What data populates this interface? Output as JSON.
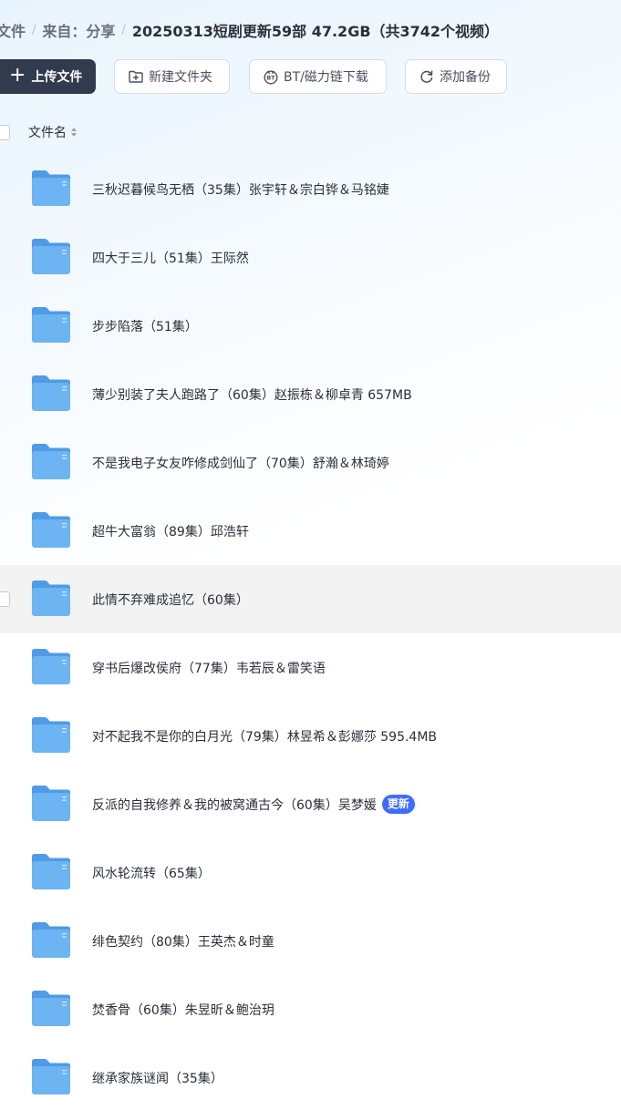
{
  "breadcrumb": {
    "items": [
      "文件",
      "来自：分享"
    ],
    "separator": "/",
    "current": "20250313短剧更新59部 47.2GB（共3742个视频）"
  },
  "toolbar": {
    "upload_label": "上传文件",
    "new_folder_label": "新建文件夹",
    "bt_label": "BT/磁力链下载",
    "backup_label": "添加备份"
  },
  "table": {
    "column_header": "文件名"
  },
  "files": [
    {
      "name": "三秋迟暮候鸟无栖（35集）张宇轩＆宗白铧＆马铭婕"
    },
    {
      "name": "四大于三儿（51集）王际然"
    },
    {
      "name": "步步陷落（51集）"
    },
    {
      "name": "薄少别装了夫人跑路了（60集）赵振栋＆柳卓青  657MB"
    },
    {
      "name": "不是我电子女友咋修成剑仙了（70集）舒瀚＆林琦婷"
    },
    {
      "name": "超牛大富翁（89集）邱浩轩"
    },
    {
      "name": "此情不弃难成追忆（60集）"
    },
    {
      "name": "穿书后爆改侯府（77集）韦若辰＆雷笑语"
    },
    {
      "name": "对不起我不是你的白月光（79集）林昱希＆彭娜莎 595.4MB"
    },
    {
      "name": "反派的自我修养＆我的被窝通古今（60集）吴梦媛",
      "badge": "更新"
    },
    {
      "name": "风水轮流转（65集）"
    },
    {
      "name": "绯色契约（80集）王英杰＆时童"
    },
    {
      "name": "焚香骨（60集）朱昱昕＆鲍治玥"
    },
    {
      "name": "继承家族谜闻（35集）"
    }
  ],
  "hovered_row": 6,
  "colors": {
    "primary_button": "#323a4e",
    "badge": "#3f6bfe",
    "folder": "#5aa7ee",
    "row_hover": "#f3f3f4"
  }
}
